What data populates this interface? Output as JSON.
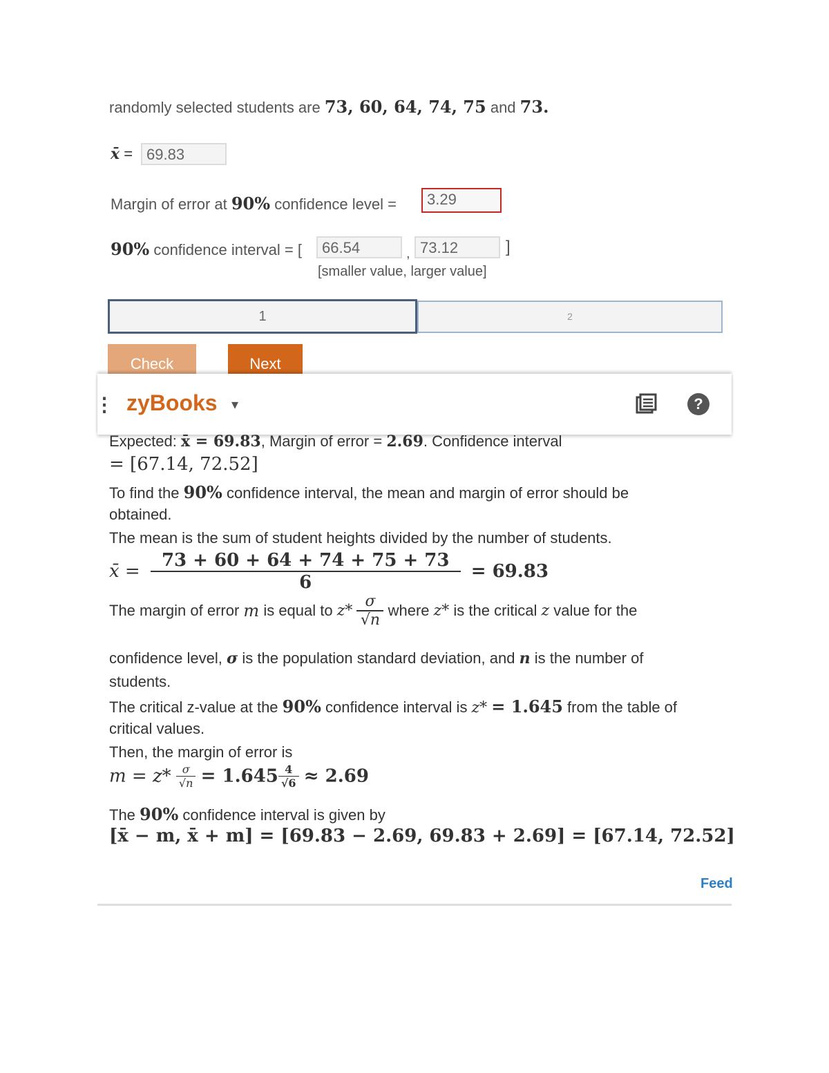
{
  "question": {
    "intro_text": "randomly selected students are",
    "values_text": "73, 60, 64, 74, 75",
    "and_text": "and",
    "last_value": "73.",
    "mean_symbol": "x̄",
    "eq": "=",
    "mean_value": "69.83",
    "margin_label_pre": "Margin of error at",
    "margin_pct": "90%",
    "margin_label_post": "confidence level =",
    "margin_value": "3.29",
    "ci_pct": "90%",
    "ci_label": "confidence interval = [",
    "ci_lower": "66.54",
    "ci_comma": ",",
    "ci_upper": "73.12",
    "ci_close": "]",
    "ci_hint": "[smaller value, larger value]"
  },
  "progress": {
    "steps": [
      "1",
      "2"
    ],
    "active_step": 1
  },
  "buttons": {
    "check": "Check",
    "next": "Next"
  },
  "header": {
    "menu_icon": "⋮",
    "brand": "zyBooks",
    "dropdown_icon": "▾",
    "book_icon": "book-icon",
    "help_icon": "?"
  },
  "solution": {
    "expected_label": "Expected:",
    "expected_mean": "x̄ = 69.83",
    "expected_margin_label": ", Margin of error =",
    "expected_margin": "2.69",
    "expected_ci_label": ". Confidence interval",
    "expected_ci": "= [67.14, 72.52]",
    "p1_pre": "To find the",
    "p1_pct": "90%",
    "p1_post": "confidence interval, the mean and margin of error should be",
    "p1_line2": "obtained.",
    "p2": "The mean is the sum of student heights divided by the number of students.",
    "mean_lhs": "x̄ =",
    "mean_num": "73 + 60 + 64 + 74 + 75 + 73",
    "mean_den": "6",
    "mean_rhs": "= 69.83",
    "p3_pre": "The margin of error",
    "p3_m": "m",
    "p3_mid": "is equal to",
    "p3_z": "z*",
    "p3_sigma": "σ",
    "p3_sqrtn": "√n",
    "p3_where": "where",
    "p3_z2": "z*",
    "p3_post": "is the critical",
    "p3_zz": "z",
    "p3_end": "value for the",
    "p4_pre": "confidence level,",
    "p4_sigma": "σ",
    "p4_mid": "is the population standard deviation, and",
    "p4_n": "n",
    "p4_end": "is the number of",
    "p4_line2": "students.",
    "p5_pre": "The critical z-value at the",
    "p5_pct": "90%",
    "p5_mid": "confidence interval is",
    "p5_z": "z*",
    "p5_val": "= 1.645",
    "p5_post": "from the table of",
    "p5_line2": "critical values.",
    "p6": "Then, the margin of error is",
    "me_lhs": "m = z*",
    "me_f1_num": "σ",
    "me_f1_den": "√n",
    "me_mid": "= 1.645",
    "me_f2_num": "4",
    "me_f2_den": "√6",
    "me_rhs": "≈ 2.69",
    "p7_pre": "The",
    "p7_pct": "90%",
    "p7_post": "confidence interval is given by",
    "ci_formula": "[x̄ − m, x̄ + m] = [69.83 − 2.69, 69.83 + 2.69] = [67.14, 72.52]"
  },
  "feedback_link": "Feed"
}
